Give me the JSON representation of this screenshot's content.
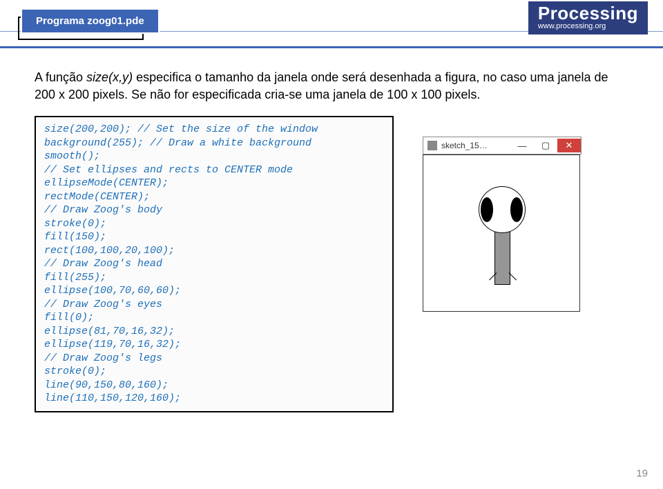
{
  "header": {
    "tab_label": "Programa zoog01.pde",
    "logo_name": "Processing",
    "logo_url": "www.processing.org"
  },
  "intro": {
    "prefix": "A função ",
    "fn": "size(x,y)",
    "rest": " especifica o tamanho da janela onde será desenhada a figura, no caso uma janela de 200 x 200 pixels. Se não for especificada cria-se uma janela de 100 x 100 pixels."
  },
  "code": {
    "l1": "size(200,200); // Set the size of the window",
    "l2": "background(255); // Draw a white background",
    "l3": "smooth();",
    "l4": "// Set ellipses and rects to CENTER mode",
    "l5": "ellipseMode(CENTER);",
    "l6": "rectMode(CENTER);",
    "l7": "// Draw Zoog's body",
    "l8": "stroke(0);",
    "l9": "fill(150);",
    "l10": "rect(100,100,20,100);",
    "l11": "// Draw Zoog's head",
    "l12": "fill(255);",
    "l13": "ellipse(100,70,60,60);",
    "l14": "// Draw Zoog's eyes",
    "l15": "fill(0);",
    "l16": "ellipse(81,70,16,32);",
    "l17": "ellipse(119,70,16,32);",
    "l18": "// Draw Zoog's legs",
    "l19": "stroke(0);",
    "l20": "line(90,150,80,160);",
    "l21": "line(110,150,120,160);"
  },
  "sketch": {
    "title": "sketch_15…",
    "min": "—",
    "max": "▢",
    "close": "✕"
  },
  "page_number": "19"
}
